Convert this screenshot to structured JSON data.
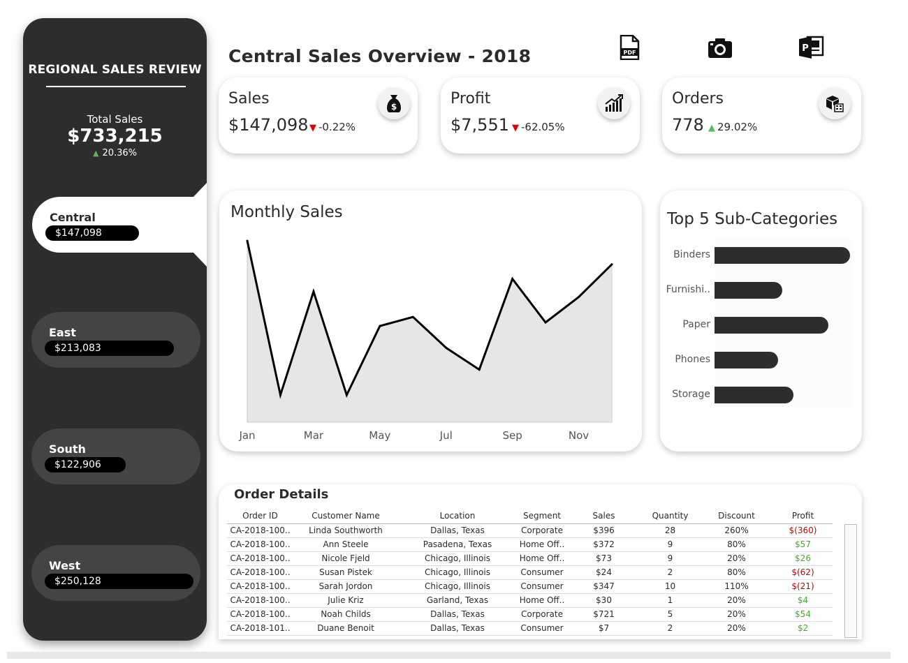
{
  "sidebar": {
    "title": "REGIONAL SALES REVIEW",
    "total_label": "Total Sales",
    "total_value": "$733,215",
    "total_change": "20.36%",
    "total_change_icon": "up-triangle-icon",
    "regions": [
      {
        "name": "Central",
        "sales": "$147,098",
        "active": true,
        "bar_fraction": 0.58
      },
      {
        "name": "East",
        "sales": "$213,083",
        "active": false,
        "bar_fraction": 0.85
      },
      {
        "name": "South",
        "sales": "$122,906",
        "active": false,
        "bar_fraction": 0.49
      },
      {
        "name": "West",
        "sales": "$250,128",
        "active": false,
        "bar_fraction": 1.0
      }
    ]
  },
  "header": {
    "title": "Central Sales Overview - 2018",
    "icons": [
      "pdf-export-icon",
      "camera-snapshot-icon",
      "powerpoint-export-icon"
    ]
  },
  "kpis": [
    {
      "label": "Sales",
      "value": "$147,098",
      "delta": "-0.22%",
      "direction": "down",
      "icon": "money-bag-icon"
    },
    {
      "label": "Profit",
      "value": "$7,551",
      "delta": "-62.05%",
      "direction": "down",
      "icon": "growth-chart-icon"
    },
    {
      "label": "Orders",
      "value": "778",
      "delta": "29.02%",
      "direction": "up",
      "icon": "boxes-icon"
    }
  ],
  "colors": {
    "sidebar": "#2d2d2d",
    "region_inactive": "#444444",
    "down": "#e00000",
    "up": "#5cb85c",
    "profit_negative": "#c40000",
    "profit_positive": "#3cb31c",
    "area_fill": "#e6e6e6",
    "line": "#000000"
  },
  "chart_data": [
    {
      "type": "area",
      "title": "Monthly Sales",
      "x": [
        "Jan",
        "Feb",
        "Mar",
        "Apr",
        "May",
        "Jun",
        "Jul",
        "Aug",
        "Sep",
        "Oct",
        "Nov",
        "Dec"
      ],
      "tick_labels": [
        "Jan",
        "Mar",
        "May",
        "Jul",
        "Sep",
        "Nov"
      ],
      "values": [
        100,
        15,
        72,
        15,
        53,
        58,
        41,
        29,
        79,
        55,
        69,
        87
      ],
      "ylim": [
        0,
        100
      ],
      "grid": false
    },
    {
      "type": "bar",
      "orientation": "horizontal",
      "title": "Top 5 Sub-Categories",
      "categories": [
        "Binders",
        "Furnishi..",
        "Paper",
        "Phones",
        "Storage"
      ],
      "values": [
        100,
        50,
        84,
        47,
        58
      ]
    }
  ],
  "orders": {
    "title": "Order Details",
    "columns": [
      "Order ID",
      "Customer Name",
      "Location",
      "Segment",
      "Sales",
      "Quantity",
      "Discount",
      "Profit"
    ],
    "rows": [
      [
        "CA-2018-100..",
        "Linda Southworth",
        "Dallas, Texas",
        "Corporate",
        "$396",
        "28",
        "260%",
        "$(360)"
      ],
      [
        "CA-2018-100..",
        "Ann Steele",
        "Pasadena, Texas",
        "Home Off..",
        "$372",
        "9",
        "80%",
        "$57"
      ],
      [
        "CA-2018-100..",
        "Nicole Fjeld",
        "Chicago, Illinois",
        "Home Off..",
        "$73",
        "9",
        "20%",
        "$26"
      ],
      [
        "CA-2018-100..",
        "Susan Pistek",
        "Chicago, Illinois",
        "Consumer",
        "$24",
        "2",
        "80%",
        "$(62)"
      ],
      [
        "CA-2018-100..",
        "Sarah Jordon",
        "Chicago, Illinois",
        "Consumer",
        "$347",
        "10",
        "110%",
        "$(21)"
      ],
      [
        "CA-2018-100..",
        "Julie Kriz",
        "Garland, Texas",
        "Home Off..",
        "$30",
        "1",
        "20%",
        "$4"
      ],
      [
        "CA-2018-100..",
        "Noah Childs",
        "Dallas, Texas",
        "Corporate",
        "$721",
        "5",
        "20%",
        "$54"
      ],
      [
        "CA-2018-101..",
        "Duane Benoit",
        "Dallas, Texas",
        "Consumer",
        "$7",
        "2",
        "20%",
        "$2"
      ]
    ]
  }
}
